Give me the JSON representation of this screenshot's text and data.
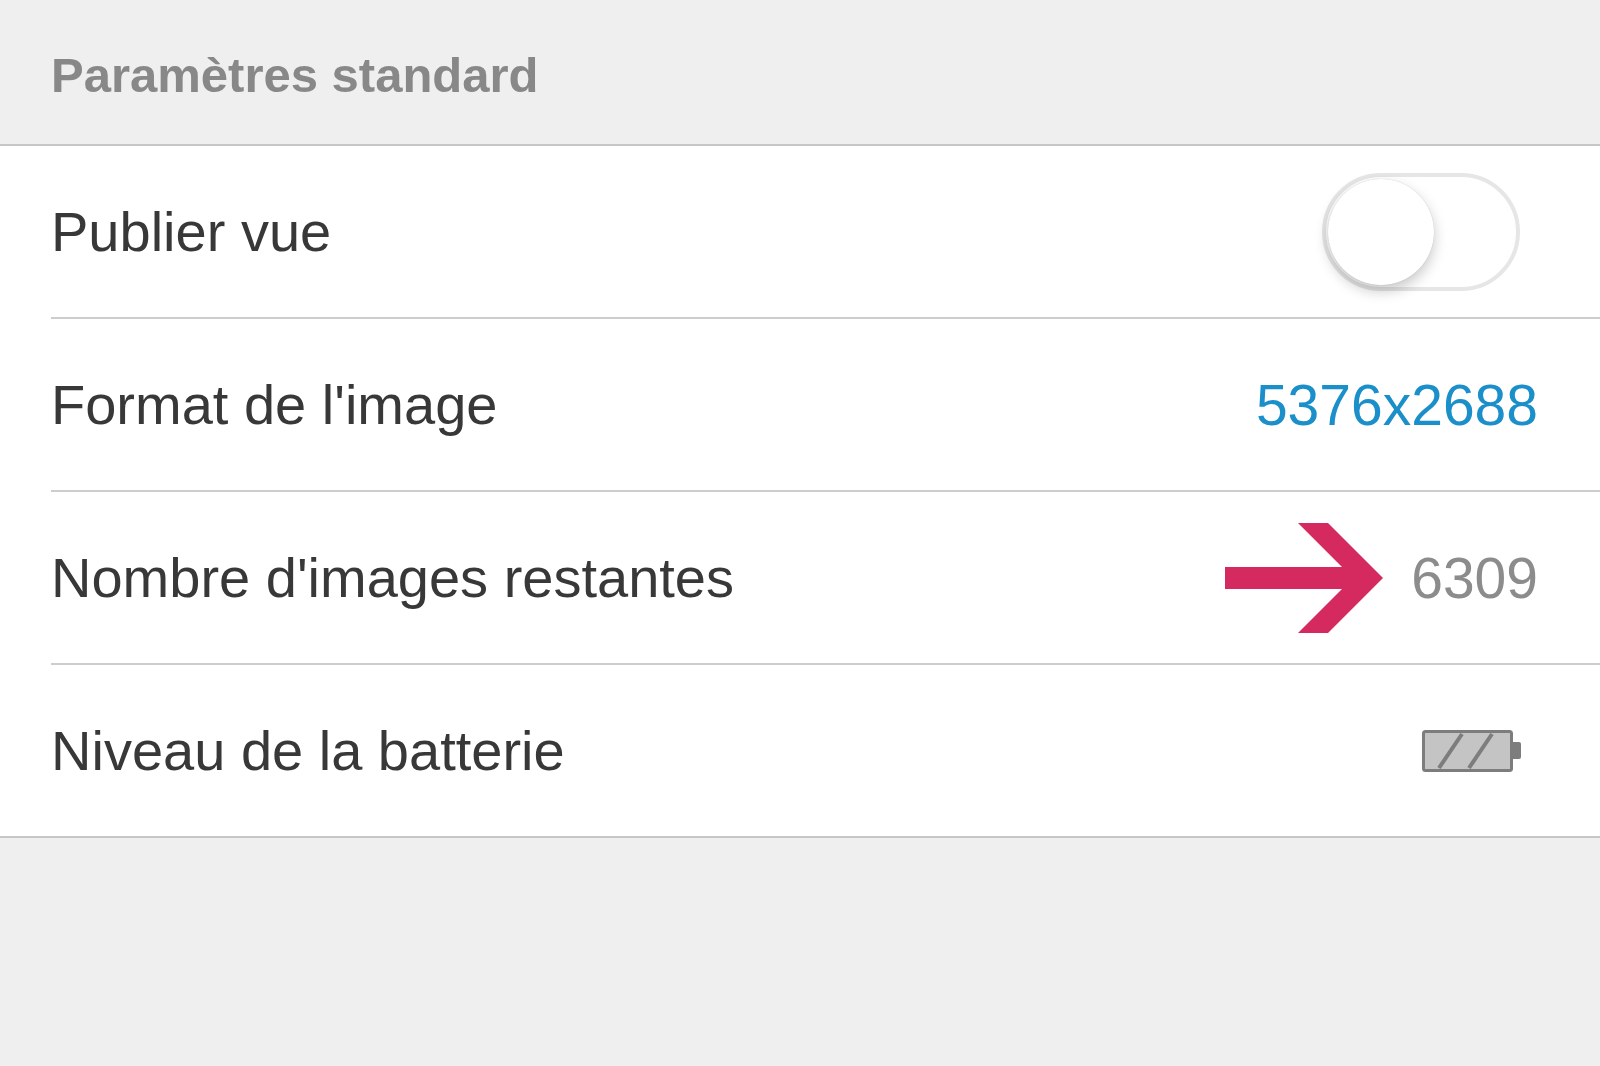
{
  "header": {
    "title": "Paramètres standard"
  },
  "rows": [
    {
      "kind": "toggle",
      "label": "Publier vue",
      "on": false,
      "marked": false
    },
    {
      "kind": "choice",
      "label": "Format de l'image",
      "value": "5376x2688",
      "marked": false
    },
    {
      "kind": "value",
      "label": "Nombre d'images restantes",
      "value": "6309",
      "marked": true
    },
    {
      "kind": "battery",
      "label": "Niveau de la batterie",
      "marked": false
    }
  ]
}
